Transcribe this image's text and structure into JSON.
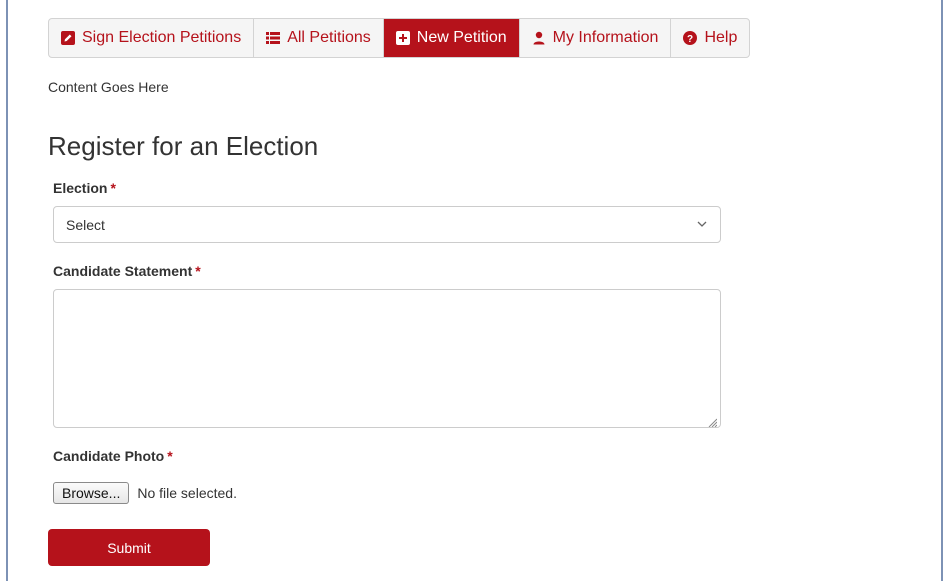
{
  "nav": {
    "items": [
      {
        "label": "Sign Election Petitions",
        "icon": "pencil-square-icon"
      },
      {
        "label": "All Petitions",
        "icon": "list-icon"
      },
      {
        "label": "New Petition",
        "icon": "plus-square-icon",
        "active": true
      },
      {
        "label": "My Information",
        "icon": "user-icon"
      },
      {
        "label": "Help",
        "icon": "question-circle-icon"
      }
    ]
  },
  "content_note": "Content Goes Here",
  "form": {
    "title": "Register for an Election",
    "required_marker": "*",
    "election": {
      "label": "Election",
      "selected": "Select"
    },
    "statement": {
      "label": "Candidate Statement",
      "value": ""
    },
    "photo": {
      "label": "Candidate Photo",
      "browse_label": "Browse...",
      "status": "No file selected."
    },
    "submit_label": "Submit"
  },
  "colors": {
    "accent": "#b5121b",
    "text": "#333333",
    "border": "#cccccc"
  }
}
